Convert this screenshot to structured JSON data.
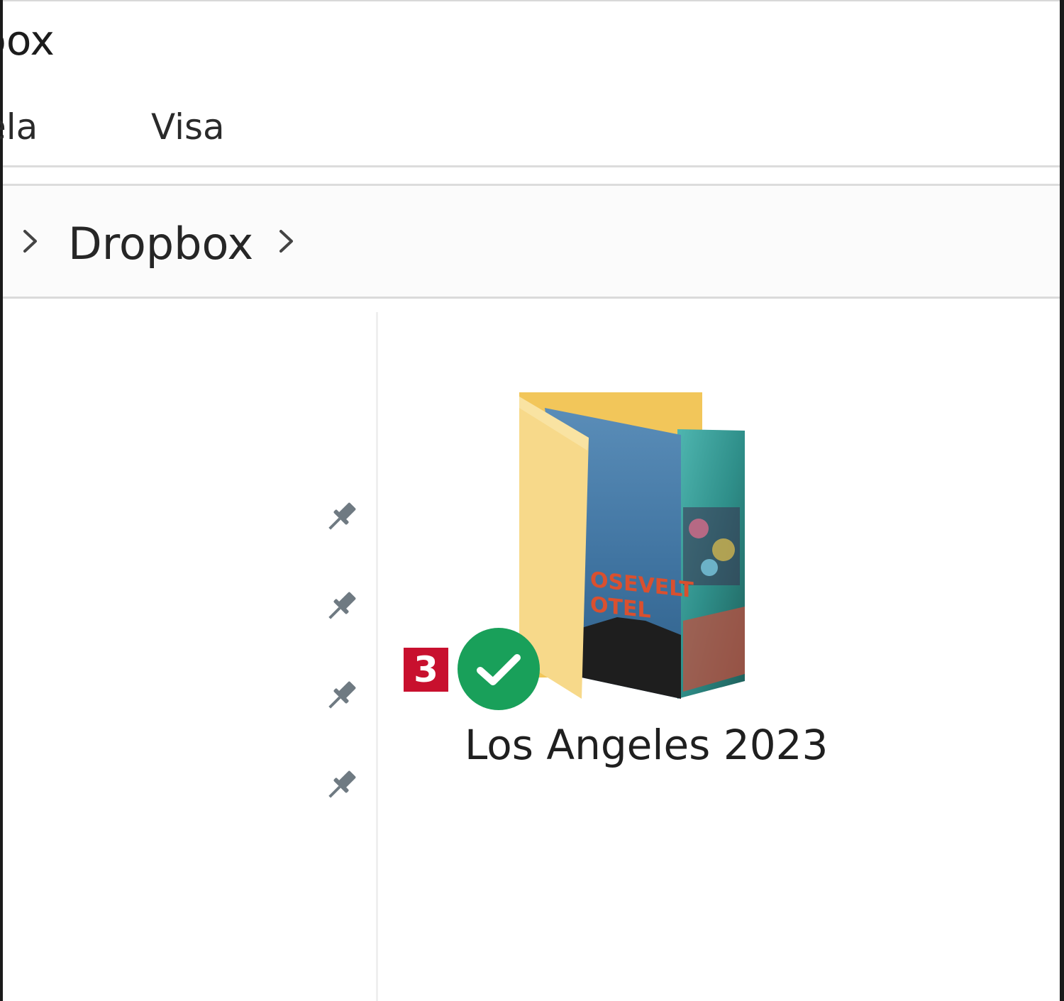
{
  "window": {
    "title": "box"
  },
  "menu": {
    "items": [
      {
        "label": "ela"
      },
      {
        "label": "Visa"
      }
    ]
  },
  "address_bar": {
    "crumbs": [
      {
        "label": "Dropbox"
      }
    ]
  },
  "navigation_pane": {
    "pinned_count": 4
  },
  "content": {
    "items": [
      {
        "name": "Los Angeles 2023",
        "type": "folder",
        "sync_status": "synced",
        "icon": "folder-with-photo-preview-icon",
        "thumbnail_text": "OSEVELT OTEL"
      }
    ]
  },
  "annotation": {
    "step_number": "3",
    "color": "#c8102e"
  },
  "colors": {
    "sync_green": "#19a05a",
    "folder_yellow": "#f7d26a",
    "pin_gray": "#6f7a82"
  }
}
